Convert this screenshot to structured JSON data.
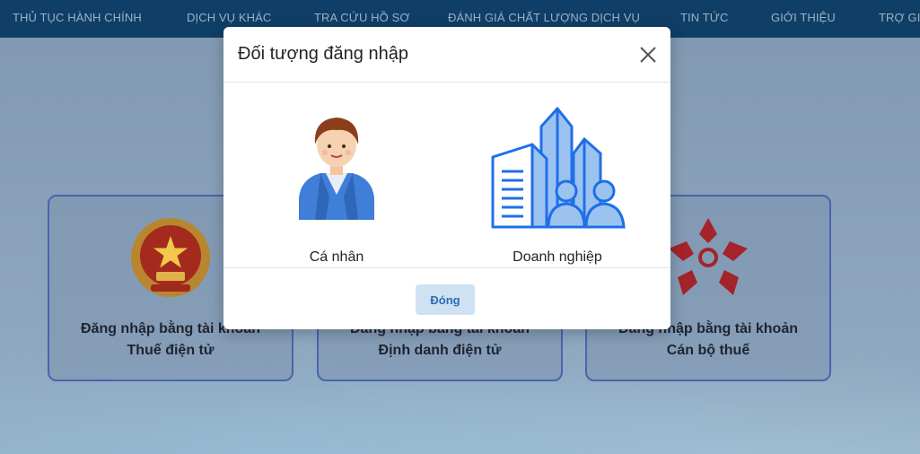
{
  "nav": {
    "items": [
      "THỦ TỤC HÀNH CHÍNH",
      "DỊCH VỤ KHÁC",
      "TRA CỨU HỒ SƠ",
      "ĐÁNH GIÁ CHẤT LƯỢNG DỊCH VỤ",
      "TIN TỨC",
      "GIỚI THIỆU",
      "TRỢ GIÚ"
    ]
  },
  "cards": [
    {
      "line1": "Đăng nhập bằng tài khoản",
      "line2": "Thuế điện tử",
      "icon": "national-emblem-icon"
    },
    {
      "line1": "Đăng nhập bằng tài khoản",
      "line2": "Định danh điện tử",
      "icon": "id-icon"
    },
    {
      "line1": "Đăng nhập bằng tài khoản",
      "line2": "Cán bộ thuế",
      "icon": "tax-logo-icon"
    }
  ],
  "modal": {
    "title": "Đối tượng đăng nhập",
    "options": [
      {
        "label": "Cá nhân",
        "icon": "person-icon"
      },
      {
        "label": "Doanh nghiệp",
        "icon": "buildings-icon"
      }
    ],
    "close_label": "Đóng"
  },
  "colors": {
    "nav_bg": "#0f3e66",
    "accent": "#1f6fe8",
    "card_border": "#4b63b0",
    "footer_button_bg": "#cfe2f3"
  }
}
